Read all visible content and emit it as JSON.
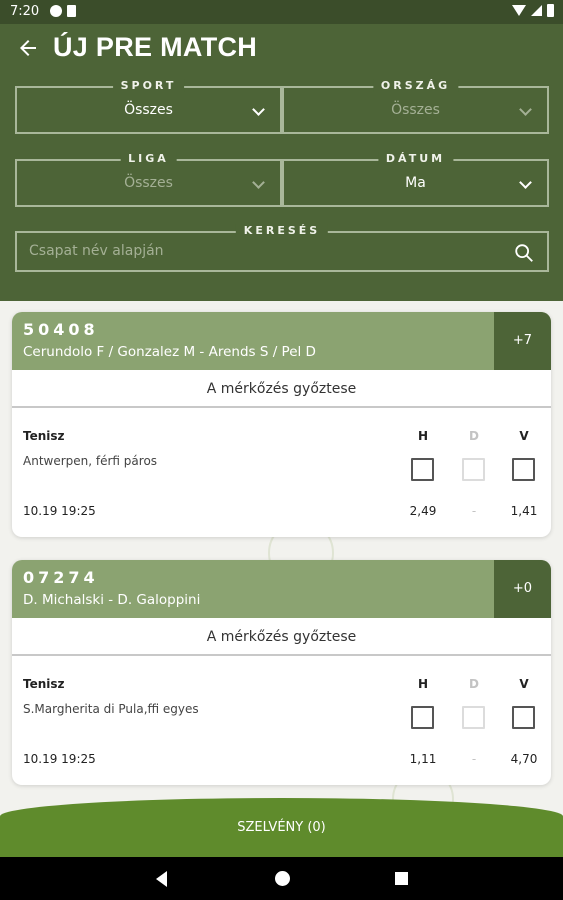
{
  "status_bar": {
    "time": "7:20"
  },
  "header": {
    "title": "ÚJ PRE MATCH"
  },
  "filters": {
    "sport": {
      "label": "SPORT",
      "value": "Összes"
    },
    "country": {
      "label": "ORSZÁG",
      "value": "Összes"
    },
    "league": {
      "label": "LIGA",
      "value": "Összes"
    },
    "date": {
      "label": "DÁTUM",
      "value": "Ma"
    },
    "search": {
      "label": "KERESÉS",
      "placeholder": "Csapat név alapján"
    }
  },
  "odds_columns": {
    "home": "H",
    "draw": "D",
    "away": "V"
  },
  "events": [
    {
      "code": "50408",
      "teams": "Cerundolo F / Gonzalez M - Arends S / Pel D",
      "more": "+7",
      "market": "A mérkőzés győztese",
      "sport": "Tenisz",
      "league": "Antwerpen, férfi páros",
      "datetime": "10.19 19:25",
      "odds": {
        "home": "2,49",
        "draw": "-",
        "away": "1,41"
      }
    },
    {
      "code": "07274",
      "teams": "D. Michalski - D. Galoppini",
      "more": "+0",
      "market": "A mérkőzés győztese",
      "sport": "Tenisz",
      "league": "S.Margherita di Pula,ffi egyes",
      "datetime": "10.19 19:25",
      "odds": {
        "home": "1,11",
        "draw": "-",
        "away": "4,70"
      }
    }
  ],
  "bet_slip": {
    "label": "SZELVÉNY (0)"
  },
  "colors": {
    "header_bg": "#4d6437",
    "card_header": "#8ba371",
    "accent_dark": "#4d6437",
    "button_green": "#5f8b2c"
  }
}
